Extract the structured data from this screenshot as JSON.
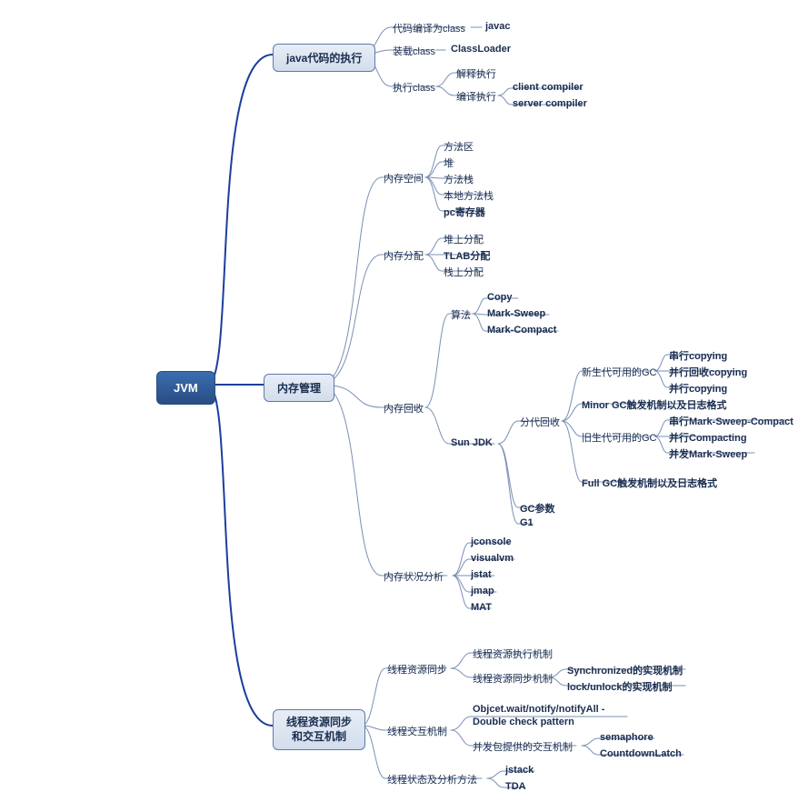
{
  "root": "JVM",
  "c1": {
    "title": "java代码的执行",
    "a1": "代码编译为class",
    "a1v": "javac",
    "a2": "装载class",
    "a2v": "ClassLoader",
    "a3": "执行class",
    "a3a": "解释执行",
    "a3b": "编译执行",
    "a3b1": "client compiler",
    "a3b2": "server compiler"
  },
  "c2": {
    "title": "内存管理",
    "s1": "内存空间",
    "s1a": "方法区",
    "s1b": "堆",
    "s1c": "方法栈",
    "s1d": "本地方法栈",
    "s1e": "pc寄存器",
    "s2": "内存分配",
    "s2a": "堆上分配",
    "s2b": "TLAB分配",
    "s2c": "栈上分配",
    "s3": "内存回收",
    "s3a": "算法",
    "s3a1": "Copy",
    "s3a2": "Mark-Sweep",
    "s3a3": "Mark-Compact",
    "s3b": "Sun JDK",
    "s3b1": "分代回收",
    "s3b1a": "新生代可用的GC",
    "s3b1a1": "串行copying",
    "s3b1a2": "并行回收copying",
    "s3b1a3": "并行copying",
    "s3b1b": "Minor GC触发机制以及日志格式",
    "s3b1c": "旧生代可用的GC",
    "s3b1c1": "串行Mark-Sweep-Compact",
    "s3b1c2": "并行Compacting",
    "s3b1c3": "并发Mark-Sweep",
    "s3b1d": "Full GC触发机制以及日志格式",
    "s3b2": "GC参数",
    "s3b3": "G1",
    "s4": "内存状况分析",
    "s4a": "jconsole",
    "s4b": "visualvm",
    "s4c": "jstat",
    "s4d": "jmap",
    "s4e": "MAT"
  },
  "c3": {
    "title_l1": "线程资源同步",
    "title_l2": "和交互机制",
    "t1": "线程资源同步",
    "t1a": "线程资源执行机制",
    "t1b": "线程资源同步机制",
    "t1b1": "Synchronized的实现机制",
    "t1b2": "lock/unlock的实现机制",
    "t2": "线程交互机制",
    "t2a_l1": "Objcet.wait/notify/notifyAll -",
    "t2a_l2": "Double check pattern",
    "t2b": "并发包提供的交互机制",
    "t2b1": "semaphore",
    "t2b2": "CountdownLatch",
    "t3": "线程状态及分析方法",
    "t3a": "jstack",
    "t3b": "TDA"
  }
}
